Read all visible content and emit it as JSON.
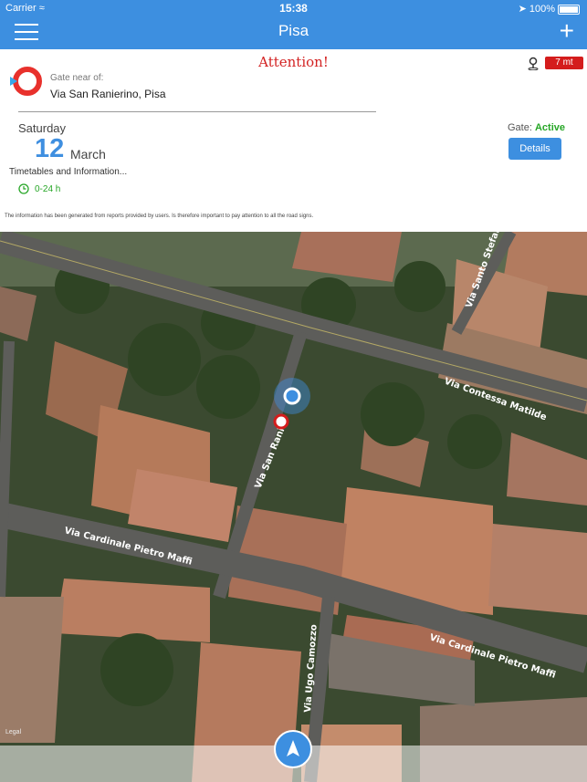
{
  "status_bar": {
    "carrier": "Carrier",
    "time": "15:38",
    "battery": "100%"
  },
  "nav": {
    "title": "Pisa"
  },
  "panel": {
    "attention": "Attention!",
    "gate_near_label": "Gate near of:",
    "address": "Via San Ranierino, Pisa",
    "distance": "7 mt",
    "weekday": "Saturday",
    "day": "12",
    "month": "March",
    "timetables_label": "Timetables and Information...",
    "hours": "0-24 h",
    "gate_label": "Gate:",
    "gate_status": "Active",
    "details_label": "Details",
    "disclaimer": "The information has been generated from reports provided by users. Is therefore important to pay attention to all the road signs."
  },
  "map": {
    "streets": [
      "Via Contessa Matilde",
      "Via San Ranie",
      "Via Santo Stefano",
      "Via Cardinale Pietro Maffi",
      "Via Cardinale Pietro Maffi",
      "Via Ugo Camozzo"
    ],
    "legal": "Legal"
  },
  "colors": {
    "accent": "#3d8fe0",
    "alert": "#d32222",
    "active": "#26a626"
  },
  "icons": {
    "menu": "hamburger-menu-icon",
    "add": "plus-icon",
    "logo": "gate-logo-icon",
    "distance": "map-pin-icon",
    "clock": "clock-icon",
    "locate": "navigation-arrow-icon",
    "user_location": "user-location-icon",
    "gate_marker": "gate-marker-icon"
  }
}
